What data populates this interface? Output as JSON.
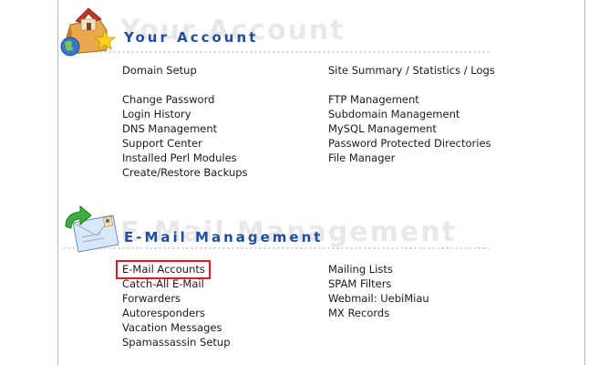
{
  "account": {
    "title": "Your Account",
    "ghost": "Your Account",
    "left_links": [
      "Domain Setup",
      "",
      "Change Password",
      "Login History",
      "DNS Management",
      "Support Center",
      "Installed Perl Modules",
      "Create/Restore Backups"
    ],
    "right_links": [
      "Site Summary / Statistics / Logs",
      "",
      "FTP Management",
      "Subdomain Management",
      "MySQL Management",
      "Password Protected Directories",
      "File Manager"
    ]
  },
  "email": {
    "title": "E-Mail Management",
    "ghost": "E-Mail Management",
    "left_links": [
      "E-Mail Accounts",
      "Catch-All E-Mail",
      "Forwarders",
      "Autoresponders",
      "Vacation Messages",
      "Spamassassin Setup"
    ],
    "right_links": [
      "Mailing Lists",
      "SPAM Filters",
      "Webmail: UebiMiau",
      "MX Records"
    ],
    "highlighted_link": "E-Mail Accounts",
    "highlight_color": "#d0202a"
  },
  "colors": {
    "section_title": "#1f4e9c",
    "link_text": "#1a1a1a",
    "frame": "#b9b9b9"
  },
  "icons": {
    "account": "house-star-globe-icon",
    "email": "envelope-arrow-icon"
  }
}
